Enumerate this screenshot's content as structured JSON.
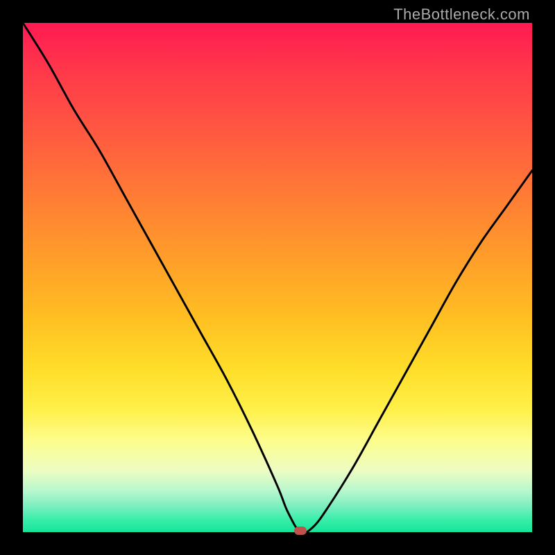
{
  "watermark": "TheBottleneck.com",
  "chart_data": {
    "type": "line",
    "title": "",
    "xlabel": "",
    "ylabel": "",
    "xlim": [
      0,
      100
    ],
    "ylim": [
      0,
      100
    ],
    "series": [
      {
        "name": "bottleneck-curve",
        "x": [
          0,
          5,
          10,
          15,
          20,
          25,
          30,
          35,
          40,
          45,
          50,
          52,
          54.5,
          57,
          60,
          65,
          70,
          75,
          80,
          85,
          90,
          95,
          100
        ],
        "values": [
          100,
          92,
          83,
          75,
          66,
          57,
          48,
          39,
          30,
          20,
          9,
          4,
          0,
          1,
          5,
          13,
          22,
          31,
          40,
          49,
          57,
          64,
          71
        ]
      }
    ],
    "marker": {
      "x": 54.5,
      "y": 0
    },
    "background_gradient": {
      "stops": [
        {
          "pos": 0.0,
          "color": "#ff1a52"
        },
        {
          "pos": 0.46,
          "color": "#ff9d2a"
        },
        {
          "pos": 0.76,
          "color": "#fff04a"
        },
        {
          "pos": 1.0,
          "color": "#14e59a"
        }
      ]
    }
  }
}
